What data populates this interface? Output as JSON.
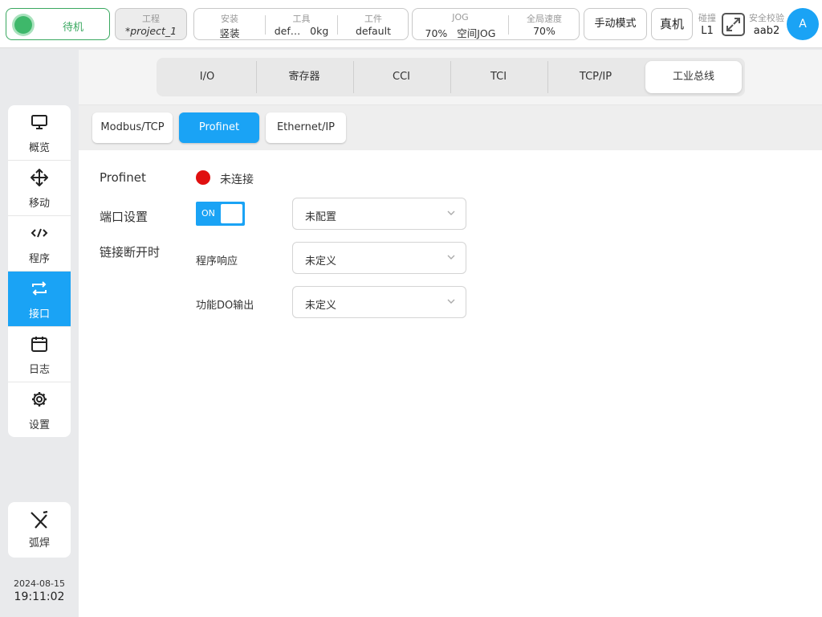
{
  "topbar": {
    "status": "待机",
    "project": {
      "title": "工程",
      "value": "*project_1"
    },
    "install": {
      "title": "安装",
      "value": "竖装"
    },
    "tool": {
      "title": "工具",
      "value": "def…   0kg"
    },
    "workpiece": {
      "title": "工件",
      "value": "default"
    },
    "jog": {
      "title": "JOG",
      "value": "70%   空间JOG"
    },
    "global_speed": {
      "title": "全局速度",
      "value": "70%"
    },
    "manual_mode": "手动模式",
    "real_robot": "真机",
    "collision": {
      "title": "碰撞",
      "value": "L1"
    },
    "safety": {
      "title": "安全校验",
      "value": "aab2"
    },
    "avatar": "A"
  },
  "nav": {
    "items": [
      {
        "label": "概览",
        "icon": "monitor-icon"
      },
      {
        "label": "移动",
        "icon": "move-arrows-icon"
      },
      {
        "label": "程序",
        "icon": "code-icon"
      },
      {
        "label": "接口",
        "icon": "swap-arrows-icon",
        "active": true
      },
      {
        "label": "日志",
        "icon": "calendar-icon"
      },
      {
        "label": "设置",
        "icon": "gear-icon"
      }
    ],
    "weld": {
      "label": "弧焊",
      "icon": "weld-torch-icon"
    },
    "date": "2024-08-15",
    "time": "19:11:02"
  },
  "tabs": [
    "I/O",
    "寄存器",
    "CCI",
    "TCI",
    "TCP/IP",
    "工业总线"
  ],
  "active_tab": "工业总线",
  "subtabs": [
    "Modbus/TCP",
    "Profinet",
    "Ethernet/IP"
  ],
  "active_subtab": "Profinet",
  "content": {
    "profinet_label": "Profinet",
    "connection_status": "未连接",
    "status_color": "#e01010",
    "port_label": "端口设置",
    "toggle_label": "ON",
    "port_select": "未配置",
    "disconnect_label": "链接断开时",
    "program_response_label": "程序响应",
    "program_response_value": "未定义",
    "do_output_label": "功能DO输出",
    "do_output_value": "未定义"
  },
  "colors": {
    "accent": "#1aa3f5",
    "status_ok": "#3eb86a",
    "error": "#e01010"
  }
}
